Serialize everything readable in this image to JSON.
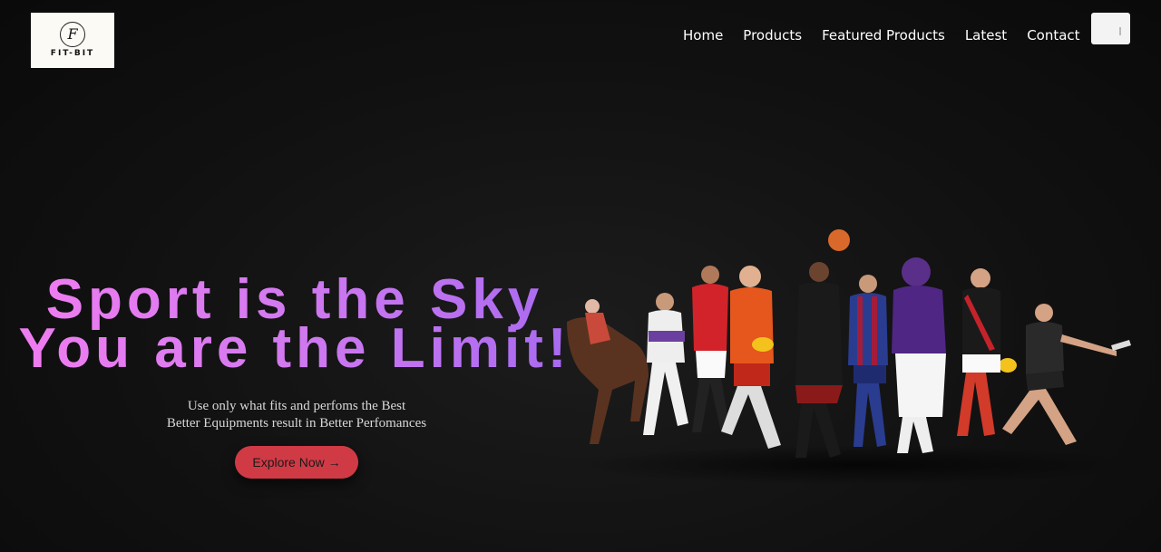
{
  "brand": {
    "name": "FIT-BIT",
    "mark": "F"
  },
  "nav": {
    "items": [
      {
        "label": "Home"
      },
      {
        "label": "Products"
      },
      {
        "label": "Featured Products"
      },
      {
        "label": "Latest"
      },
      {
        "label": "Contact"
      }
    ],
    "menu_icon": "menu-icon"
  },
  "hero": {
    "headline_line1": "Sport is the Sky",
    "headline_line2": "You are the Limit!",
    "tagline_line1": "Use only what fits and perfoms the Best",
    "tagline_line2": "Better Equipments result in Better Perfomances",
    "cta_label": "Explore Now →",
    "image": "athletes-collage"
  },
  "colors": {
    "background": "#111111",
    "headline_start": "#f07cf0",
    "headline_end": "#a86af0",
    "cta": "#d03a45",
    "nav_text": "#ffffff"
  }
}
